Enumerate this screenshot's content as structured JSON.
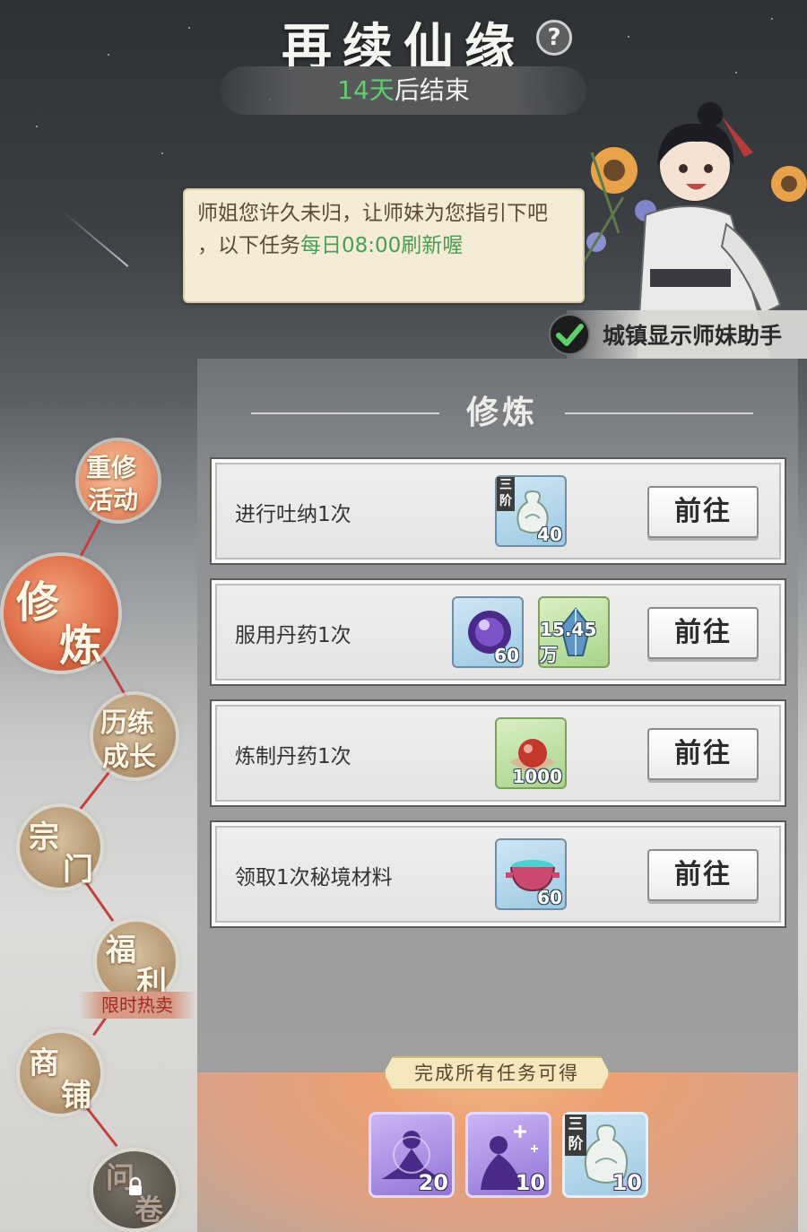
{
  "header": {
    "title": "再续仙缘",
    "help_symbol": "?",
    "timer_days": "14天",
    "timer_suffix": "后结束"
  },
  "assistant": {
    "speech_line1": "师姐您许久未归，让师妹为您指引下吧",
    "speech_line2_prefix": "，以下任务",
    "speech_line2_highlight": "每日08:00刷新喔",
    "toggle_label": "城镇显示师妹助手",
    "toggle_checked": true
  },
  "nav": {
    "items": [
      {
        "line1": "重修",
        "line2": "活动"
      },
      {
        "line1": "修",
        "line2": "炼"
      },
      {
        "line1": "历练",
        "line2": "成长"
      },
      {
        "line1": "宗",
        "line2": "门"
      },
      {
        "line1": "福",
        "line2": "利"
      },
      {
        "line1": "商",
        "line2": "铺"
      },
      {
        "line1": "问",
        "line2": "卷"
      }
    ],
    "promo_tag": "限时热卖"
  },
  "section": {
    "title": "修炼"
  },
  "tasks": [
    {
      "label": "进行吐纳1次",
      "button": "前往",
      "rewards": [
        {
          "icon": "tier3-vase-icon",
          "tier": "三阶",
          "qty": "40"
        }
      ]
    },
    {
      "label": "服用丹药1次",
      "button": "前往",
      "rewards": [
        {
          "icon": "purple-orb-icon",
          "qty": "60"
        },
        {
          "icon": "blue-crystal-icon",
          "qty": "15.45万"
        }
      ]
    },
    {
      "label": "炼制丹药1次",
      "button": "前往",
      "rewards": [
        {
          "icon": "red-pill-icon",
          "qty": "1000"
        }
      ]
    },
    {
      "label": "领取1次秘境材料",
      "button": "前往",
      "rewards": [
        {
          "icon": "cauldron-icon",
          "qty": "60"
        }
      ]
    }
  ],
  "completion": {
    "title": "完成所有任务可得",
    "rewards": [
      {
        "icon": "meditating-figure-icon",
        "qty": "20"
      },
      {
        "icon": "sparkle-figure-icon",
        "qty": "10"
      },
      {
        "icon": "tier3-vase-icon",
        "tier": "三阶",
        "qty": "10"
      }
    ]
  },
  "colors": {
    "highlight_green": "#4a9e52",
    "timer_green": "#5fcf6e",
    "active_nav": "#e06f4a",
    "nav_line": "#c2413d"
  }
}
